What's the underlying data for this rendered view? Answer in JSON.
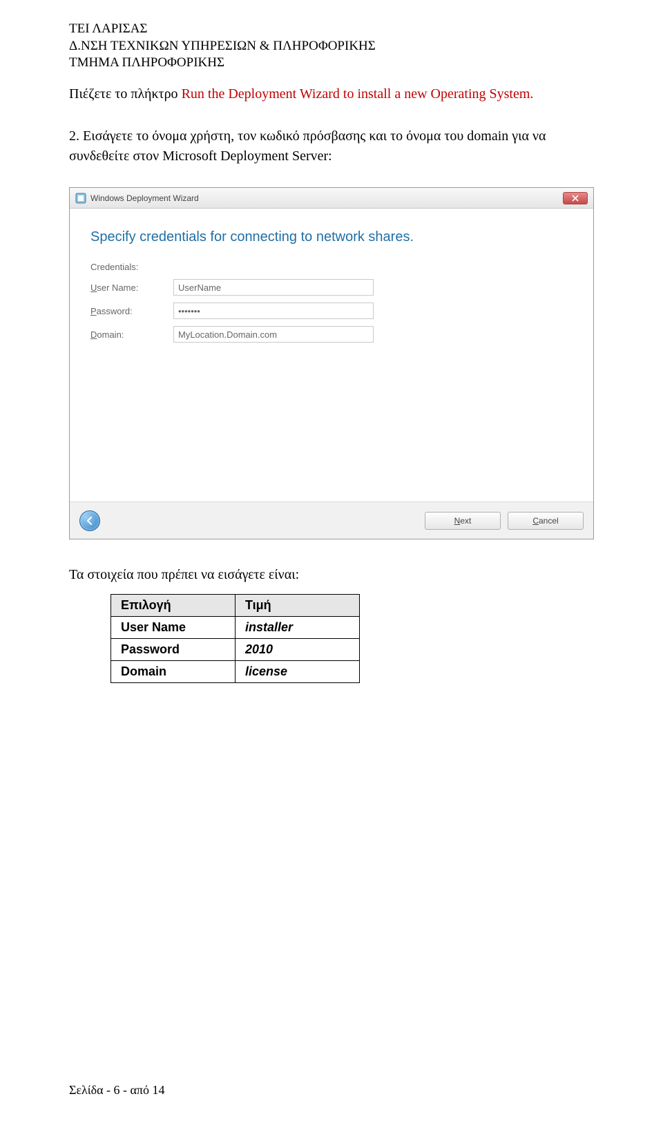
{
  "header": {
    "line1": "ΤΕΙ ΛΑΡΙΣΑΣ",
    "line2": "Δ.ΝΣΗ ΤΕΧΝΙΚΩΝ ΥΠΗΡΕΣΙΩΝ & ΠΛΗΡΟΦΟΡΙΚΗΣ",
    "line3": "ΤΜΗΜΑ ΠΛΗΡΟΦΟΡΙΚΗΣ"
  },
  "paragraph1": {
    "prefix": "Πιέζετε το πλήκτρο ",
    "highlight": "Run the  Deployment Wizard to install a new Operating System.",
    "suffix": ""
  },
  "paragraph2": "2.  Εισάγετε το όνομα χρήστη, τον κωδικό πρόσβασης και το όνομα του domain για να συνδεθείτε στον Microsoft Deployment Server:",
  "dialog": {
    "title": "Windows Deployment Wizard",
    "heading": "Specify credentials for connecting to network shares.",
    "credentials_label": "Credentials:",
    "rows": {
      "username": {
        "letter": "U",
        "rest": "ser Name:",
        "value": "UserName"
      },
      "password": {
        "letter": "P",
        "rest": "assword:",
        "value": "•••••••"
      },
      "domain": {
        "letter": "D",
        "rest": "omain:",
        "value": "MyLocation.Domain.com"
      }
    },
    "buttons": {
      "next": {
        "letter": "N",
        "rest": "ext"
      },
      "cancel": {
        "letter": "C",
        "rest": "ancel"
      }
    }
  },
  "caption": "Τα στοιχεία που πρέπει να εισάγετε είναι:",
  "table": {
    "head": {
      "c1": "Επιλογή",
      "c2": "Τιμή"
    },
    "rows": [
      {
        "key": "User Name",
        "val": "installer",
        "italic": true
      },
      {
        "key": "Password",
        "val": "2010",
        "italic": true
      },
      {
        "key": "Domain",
        "val": "license",
        "italic": true
      }
    ]
  },
  "footer": "Σελίδα - 6 - από 14"
}
